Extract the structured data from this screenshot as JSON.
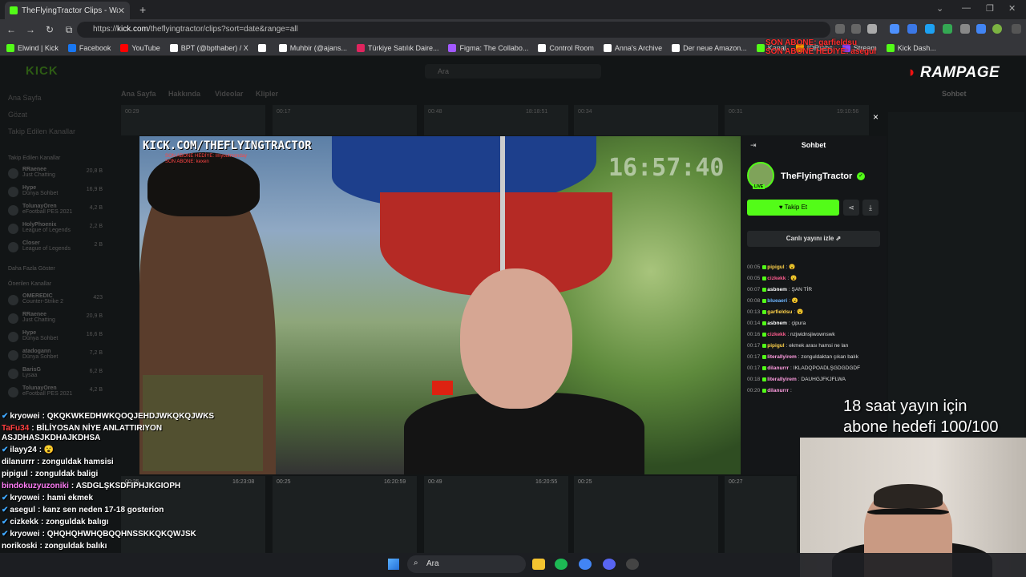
{
  "browser": {
    "tab_title": "TheFlyingTractor Clips - Wa",
    "new_tab": "+",
    "url_prefix": "https://",
    "url_host": "kick.com",
    "url_path": "/theflyingtractor/clips?sort=date&range=all",
    "bookmarks": [
      {
        "label": "Elwind | Kick",
        "color": "#53fc18"
      },
      {
        "label": "Facebook",
        "color": "#1877f2"
      },
      {
        "label": "YouTube",
        "color": "#ff0000"
      },
      {
        "label": "BPT (@bpthaber) / X",
        "color": "#ffffff"
      },
      {
        "label": "",
        "color": "#ffffff"
      },
      {
        "label": "Muhbir (@ajans...",
        "color": "#ffffff"
      },
      {
        "label": "Türkiye Satılık Daire...",
        "color": "#e0245e"
      },
      {
        "label": "Figma: The Collabo...",
        "color": "#a259ff"
      },
      {
        "label": "Control Room",
        "color": "#ffffff"
      },
      {
        "label": "Anna's Archive",
        "color": "#ffffff"
      },
      {
        "label": "Der neue Amazon...",
        "color": "#ffffff"
      },
      {
        "label": "Kanal",
        "color": "#53fc18"
      },
      {
        "label": "IDRlabs",
        "color": "#ff9900"
      },
      {
        "label": "Stream",
        "color": "#9146ff"
      },
      {
        "label": "Kick Dash...",
        "color": "#53fc18"
      }
    ]
  },
  "overlay": {
    "sub_alert_1": "SON ABONE: garfieldsu",
    "sub_alert_2": "SON ABONE HEDİYE: asegul",
    "brand": "RAMPAGE",
    "goal_line1": "18 saat yayın için",
    "goal_line2": "abone hedefi 100/100",
    "chat": [
      {
        "user": "kryowei",
        "text": "QKQKWKEDHWKQOQJEHDJWKQKQJWKS",
        "color": "#ffffff",
        "icon": true
      },
      {
        "user": "TaFu34",
        "text": "BİLİYOSAN NİYE ANLATTIRIYON ASJDHASJKDHAJKDHSA",
        "color": "#ff4040",
        "icon": false
      },
      {
        "user": "ilayy24",
        "text": "😮",
        "color": "#ffffff",
        "icon": true
      },
      {
        "user": "dilanurrr",
        "text": "zonguldak hamsisi",
        "color": "#ffffff",
        "icon": false
      },
      {
        "user": "pipigul",
        "text": "zonguldak baligi",
        "color": "#ffffff",
        "icon": false
      },
      {
        "user": "bindokuzyuzoniki",
        "text": "ASDGLŞKSDFIPHJKGIOPH",
        "color": "#ff7cf5",
        "icon": false
      },
      {
        "user": "kryowei",
        "text": "hami ekmek",
        "color": "#ffffff",
        "icon": true
      },
      {
        "user": "asegul",
        "text": "kanz sen neden 17-18 gosterion",
        "color": "#ffffff",
        "icon": true
      },
      {
        "user": "cizkekk",
        "text": "zonguldak balıgı",
        "color": "#ffffff",
        "icon": true
      },
      {
        "user": "kryowei",
        "text": "QHQHQHWHQBQQHNSSKKQKQWJSK",
        "color": "#ffffff",
        "icon": true
      },
      {
        "user": "norikoski",
        "text": "zonguldak balıkı",
        "color": "#ffffff",
        "icon": false
      }
    ]
  },
  "kick": {
    "logo": "KICK",
    "search_placeholder": "Ara",
    "nav": [
      "Ana Sayfa",
      "Gözat",
      "Takip Edilen Kanallar"
    ],
    "followed_heading": "Takip Edilen Kanallar",
    "followed": [
      {
        "name": "RRaenee",
        "sub": "Just Chatting",
        "count": "20,8 B"
      },
      {
        "name": "Hype",
        "sub": "Dünya Sohbet",
        "count": "16,9 B"
      },
      {
        "name": "TolunayOren",
        "sub": "eFootball PES 2021",
        "count": "4,2 B"
      },
      {
        "name": "HolyPhoenix",
        "sub": "League of Legends",
        "count": "2,2 B"
      },
      {
        "name": "Closer",
        "sub": "League of Legends",
        "count": "2 B"
      }
    ],
    "show_more": "Daha Fazla Göster",
    "suggested_heading": "Önerilen Kanallar",
    "suggested": [
      {
        "name": "OMEREDIC",
        "sub": "Counter-Strike 2",
        "count": "423"
      },
      {
        "name": "RRaenee",
        "sub": "Just Chatting",
        "count": "20,9 B"
      },
      {
        "name": "Hype",
        "sub": "Dünya Sohbet",
        "count": "16,6 B"
      },
      {
        "name": "atadogann",
        "sub": "Dünya Sohbet",
        "count": "7,2 B"
      },
      {
        "name": "BarisG",
        "sub": "Lysaa",
        "count": "6,2 B"
      },
      {
        "name": "TolunayOren",
        "sub": "eFootball PES 2021",
        "count": "4,2 B"
      }
    ],
    "page_tabs": [
      "Ana Sayfa",
      "Hakkında",
      "Videolar",
      "Klipler"
    ],
    "right_chat_title": "Sohbet"
  },
  "modal": {
    "close": "×",
    "video_watermark": "KICK.COM/THEFLYINGTRACTOR",
    "video_sub_1": "SON ABONE HEDİYE: Imyoutmonday",
    "video_sub_2": "SON ABONE: kexen",
    "video_clock": "16:57:40",
    "panel_title": "Sohbet",
    "channel_name": "TheFlyingTractor",
    "live_badge": "LIVE",
    "follow_label": "♥ Takip Et",
    "watch_live_label": "Canlı yayını izle ⇗",
    "chat": [
      {
        "time": "00:05",
        "user": "pipigul",
        "text": "😮",
        "color": "#ffd24a"
      },
      {
        "time": "00:05",
        "user": "cizkekk",
        "text": "😮",
        "color": "#ff5d8f"
      },
      {
        "time": "00:07",
        "user": "asbnem",
        "text": "ŞAN TİR",
        "color": "#ffffff"
      },
      {
        "time": "00:08",
        "user": "blueaeri",
        "text": "😮",
        "color": "#6fb7ff"
      },
      {
        "time": "00:13",
        "user": "garfieldsu",
        "text": "😮",
        "color": "#ffd24a"
      },
      {
        "time": "00:14",
        "user": "asbnem",
        "text": "çipura",
        "color": "#ffffff"
      },
      {
        "time": "00:16",
        "user": "cizkekk",
        "text": "nzjwidnsjiwownswk",
        "color": "#ff5d8f"
      },
      {
        "time": "00:17",
        "user": "pipigul",
        "text": "ekmek arası hamsi ne lan",
        "color": "#ffd24a"
      },
      {
        "time": "00:17",
        "user": "literallyirem",
        "text": "zonguldaktan çıkan balık",
        "color": "#ff9de0"
      },
      {
        "time": "00:17",
        "user": "dilanurrr",
        "text": "IKLADQPOADLŞGDGDGDF",
        "color": "#ff9de0"
      },
      {
        "time": "00:18",
        "user": "literallyirem",
        "text": "DAUHGJFKJFLWA",
        "color": "#ff9de0"
      },
      {
        "time": "00:20",
        "user": "dilanurrr",
        "text": "",
        "color": "#ff9de0"
      }
    ]
  },
  "thumbs_top": [
    "00:29",
    "00:17",
    "00:48",
    "18:18:51",
    "00:34",
    "00:31",
    "19:10:56"
  ],
  "thumbs_bottom": [
    "00:35",
    "16:23:08",
    "00:25",
    "16:20:59",
    "00:49",
    "16:20:55",
    "00:25",
    "00:27"
  ],
  "taskbar": {
    "search": "Ara"
  }
}
